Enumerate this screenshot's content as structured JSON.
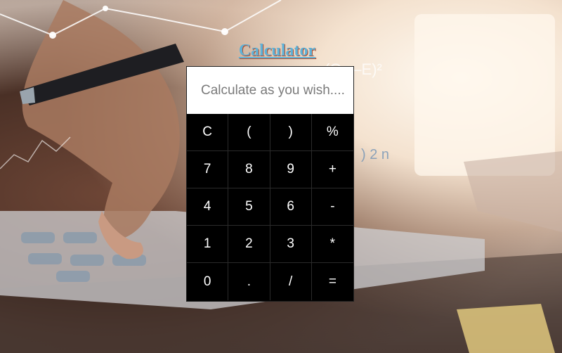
{
  "page": {
    "title": "Calculator"
  },
  "display": {
    "value": "",
    "placeholder": "Calculate as you wish...."
  },
  "background": {
    "formula_1": "(O —E)²",
    "formula_2": ") 2 n"
  },
  "keys": [
    "C",
    "(",
    ")",
    "%",
    "7",
    "8",
    "9",
    "+",
    "4",
    "5",
    "6",
    "-",
    "1",
    "2",
    "3",
    "*",
    "0",
    ".",
    "/",
    "="
  ]
}
